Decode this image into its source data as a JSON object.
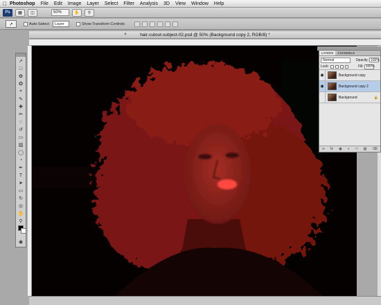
{
  "menubar": {
    "apple_icon": "apple-icon",
    "app_name": "Photoshop",
    "items": [
      "File",
      "Edit",
      "Image",
      "Layer",
      "Select",
      "Filter",
      "Analysis",
      "3D",
      "View",
      "Window",
      "Help"
    ]
  },
  "appbar": {
    "logo": "Ps",
    "zoom": "50%"
  },
  "options": {
    "auto_select_label": "Auto-Select:",
    "auto_select_value": "Layer",
    "transform_label": "Show Transform Controls"
  },
  "document": {
    "title": "hair-cutout-subject-02.psd @ 50% (Background copy 2, RGB/8) *"
  },
  "layers_panel": {
    "tabs": [
      "LAYERS",
      "CHANNELS"
    ],
    "blend_mode": "Normal",
    "opacity_label": "Opacity:",
    "opacity_value": "100%",
    "lock_label": "Lock:",
    "fill_label": "Fill:",
    "fill_value": "100%",
    "layers": [
      {
        "name": "Background copy",
        "visible": true,
        "selected": false
      },
      {
        "name": "Background copy 2",
        "visible": true,
        "selected": true
      },
      {
        "name": "Background",
        "visible": false,
        "selected": false,
        "locked": true
      }
    ],
    "footer_icons": [
      "link-icon",
      "fx-icon",
      "mask-icon",
      "adjustment-icon",
      "folder-icon",
      "new-layer-icon",
      "trash-icon"
    ]
  },
  "colors": {
    "hair": "#8a1a14",
    "skin": "#9a2a22",
    "lips": "#ff4a40",
    "selected_layer": "#b6cdea"
  }
}
